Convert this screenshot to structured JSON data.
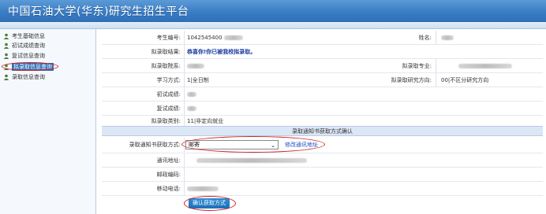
{
  "app": {
    "title": "中国石油大学(华东)研究生招生平台"
  },
  "sidebar": {
    "items": [
      {
        "label": "考生基础信息"
      },
      {
        "label": "初试成绩查询"
      },
      {
        "label": "复试信息查询"
      },
      {
        "label": "拟录取信息查询"
      },
      {
        "label": "录取信息查询"
      }
    ]
  },
  "fields": {
    "exam_no_label": "考生编号:",
    "exam_no_value": "1042545400",
    "name_label": "姓名:",
    "result_label": "拟录取结果:",
    "result_value": "恭喜你!你已被我校拟录取。",
    "dept_label": "拟录取院系:",
    "major_label": "拟录取专业:",
    "study_mode_label": "学习方式:",
    "study_mode_value": "1|全日制",
    "direction_label": "拟录取研究方向:",
    "direction_value": "00|不区分研究方向",
    "initial_score_label": "初试成绩:",
    "retest_score_label": "复试成绩:",
    "category_label": "拟录取类别:",
    "category_value": "11|非定向就业"
  },
  "section": {
    "title": "录取通知书获取方式确认"
  },
  "notice_form": {
    "method_label": "录取通知书获取方式:",
    "method_value": "邮寄",
    "modify_link": "修改通讯地址",
    "address_label": "通讯地址:",
    "postcode_label": "邮政编码:",
    "phone_label": "移动电话:",
    "confirm_button": "确认获取方式"
  },
  "colors": {
    "banner": "#3a7dc4",
    "highlight_ring": "#d02020",
    "link": "#1a4cc0",
    "button": "#1c6fb8"
  }
}
